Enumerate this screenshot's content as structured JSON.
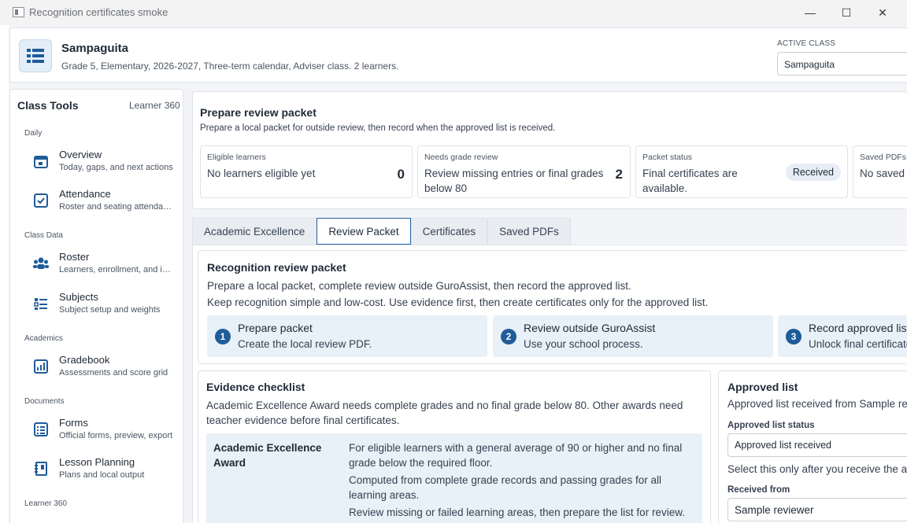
{
  "window": {
    "title": "Recognition certificates smoke",
    "minimize": "—",
    "maximize": "☐",
    "close": "✕"
  },
  "header": {
    "title": "Sampaguita",
    "subtitle": "Grade 5, Elementary, 2026-2027, Three-term calendar, Adviser class. 2 learners.",
    "active_class_label": "ACTIVE CLASS",
    "active_class_value": "Sampaguita"
  },
  "sidebar": {
    "title": "Class Tools",
    "link": "Learner 360",
    "sections": {
      "daily": "Daily",
      "class_data": "Class Data",
      "academics": "Academics",
      "documents": "Documents",
      "learner360": "Learner 360"
    },
    "items": [
      {
        "label": "Overview",
        "desc": "Today, gaps, and next actions"
      },
      {
        "label": "Attendance",
        "desc": "Roster and seating attendance"
      },
      {
        "label": "Roster",
        "desc": "Learners, enrollment, and imports"
      },
      {
        "label": "Subjects",
        "desc": "Subject setup and weights"
      },
      {
        "label": "Gradebook",
        "desc": "Assessments and score grid"
      },
      {
        "label": "Forms",
        "desc": "Official forms, preview, export"
      },
      {
        "label": "Lesson Planning",
        "desc": "Plans and local output"
      }
    ]
  },
  "prepare": {
    "title": "Prepare review packet",
    "subtitle": "Prepare a local packet for outside review, then record when the approved list is received.",
    "stats": [
      {
        "label": "Eligible learners",
        "text": "No learners eligible yet",
        "value": "0"
      },
      {
        "label": "Needs grade review",
        "text": "Review missing entries or final grades below 80",
        "value": "2"
      },
      {
        "label": "Packet status",
        "text": "Final certificates are available.",
        "badge": "Received"
      },
      {
        "label": "Saved PDFs",
        "text": "No saved PDFs"
      }
    ]
  },
  "tabs": [
    "Academic Excellence",
    "Review Packet",
    "Certificates",
    "Saved PDFs"
  ],
  "review": {
    "title": "Recognition review packet",
    "line1": "Prepare a local packet, complete review outside GuroAssist, then record the approved list.",
    "line2": "Keep recognition simple and low-cost. Use evidence first, then create certificates only for the approved list.",
    "steps": [
      {
        "num": "1",
        "title": "Prepare packet",
        "sub": "Create the local review PDF."
      },
      {
        "num": "2",
        "title": "Review outside GuroAssist",
        "sub": "Use your school process."
      },
      {
        "num": "3",
        "title": "Record approved list",
        "sub": "Unlock final certificates."
      }
    ]
  },
  "evidence": {
    "title": "Evidence checklist",
    "desc": "Academic Excellence Award needs complete grades and no final grade below 80. Other awards need teacher evidence before final certificates.",
    "award_name": "Academic Excellence Award",
    "lines": [
      "For eligible learners with a general average of 90 or higher and no final grade below the required floor.",
      "Computed from complete grade records and passing grades for all learning areas.",
      "Review missing or failed learning areas, then prepare the list for review."
    ]
  },
  "approved": {
    "title": "Approved list",
    "line": "Approved list received from Sample reviewer.",
    "status_label": "Approved list status",
    "status_value": "Approved list received",
    "hint": "Select this only after you receive the approved list.",
    "from_label": "Received from",
    "from_value": "Sample reviewer"
  }
}
